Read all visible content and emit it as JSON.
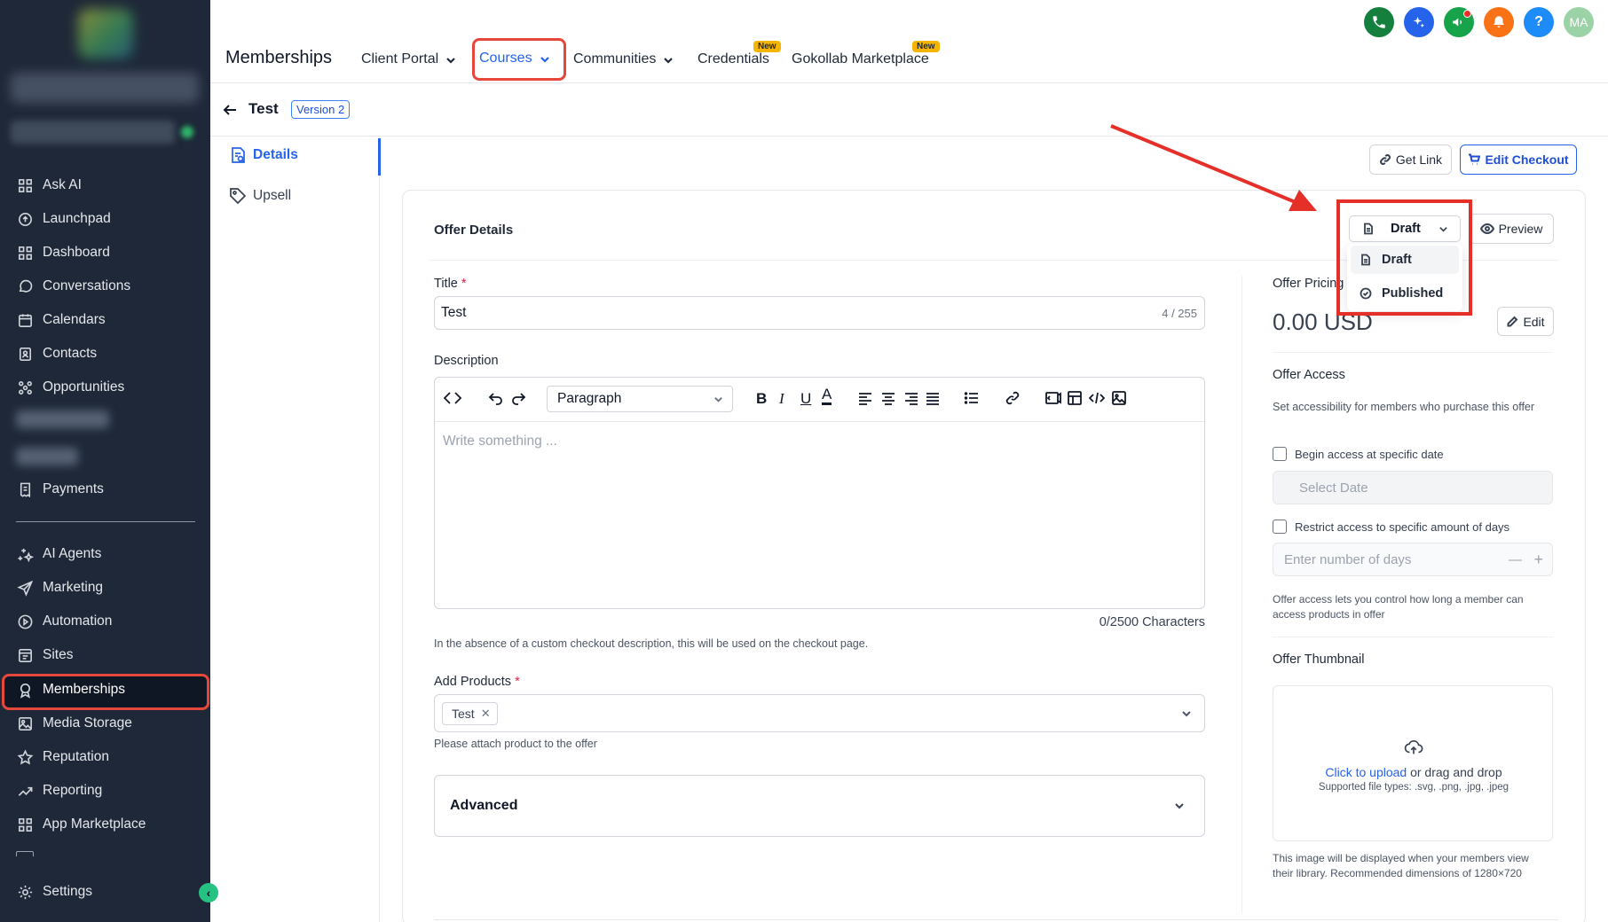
{
  "sidebar": {
    "items": [
      {
        "label": "Ask AI",
        "icon": "grid-icon"
      },
      {
        "label": "Launchpad",
        "icon": "rocket-icon"
      },
      {
        "label": "Dashboard",
        "icon": "grid-icon"
      },
      {
        "label": "Conversations",
        "icon": "chat-bubble-icon"
      },
      {
        "label": "Calendars",
        "icon": "calendar-icon"
      },
      {
        "label": "Contacts",
        "icon": "contacts-book-icon"
      },
      {
        "label": "Opportunities",
        "icon": "pipeline-icon"
      },
      {
        "label": "Payments",
        "icon": "receipt-icon"
      },
      {
        "label": "AI Agents",
        "icon": "sparkles-icon"
      },
      {
        "label": "Marketing",
        "icon": "send-icon"
      },
      {
        "label": "Automation",
        "icon": "play-circle-icon"
      },
      {
        "label": "Sites",
        "icon": "browser-icon"
      },
      {
        "label": "Memberships",
        "icon": "award-icon"
      },
      {
        "label": "Media Storage",
        "icon": "image-icon"
      },
      {
        "label": "Reputation",
        "icon": "star-icon"
      },
      {
        "label": "Reporting",
        "icon": "trend-up-icon"
      },
      {
        "label": "App Marketplace",
        "icon": "grid-icon"
      },
      {
        "label": "Settings",
        "icon": "gear-icon"
      }
    ],
    "active_item": "Memberships"
  },
  "header": {
    "app_title": "Memberships",
    "tabs": [
      {
        "label": "Client Portal",
        "has_dropdown": true
      },
      {
        "label": "Courses",
        "has_dropdown": true,
        "active": true
      },
      {
        "label": "Communities",
        "has_dropdown": true
      },
      {
        "label": "Credentials",
        "badge": "New"
      },
      {
        "label": "Gokollab Marketplace",
        "badge": "New"
      }
    ],
    "icons": [
      {
        "name": "phone-icon",
        "color": "#15803d"
      },
      {
        "name": "ai-sparkle-icon",
        "color": "#2563eb"
      },
      {
        "name": "megaphone-icon",
        "color": "#16a34a"
      },
      {
        "name": "bell-icon",
        "color": "#f97316"
      },
      {
        "name": "help-icon",
        "color": "#1d8cf8"
      }
    ],
    "avatar_initials": "MA"
  },
  "subheader": {
    "title": "Test",
    "version": "Version 2"
  },
  "inner_nav": {
    "items": [
      {
        "label": "Details",
        "active": true
      },
      {
        "label": "Upsell"
      }
    ]
  },
  "actions": {
    "get_link": "Get Link",
    "edit_checkout": "Edit Checkout",
    "preview": "Preview"
  },
  "offer": {
    "section_title": "Offer Details",
    "status": {
      "selected": "Draft",
      "options": [
        "Draft",
        "Published"
      ]
    },
    "title_label": "Title",
    "title_value": "Test",
    "title_counter": "4 / 255",
    "description_label": "Description",
    "editor": {
      "block_style": "Paragraph",
      "placeholder": "Write something ...",
      "char_count": "0/2500 Characters",
      "toolbar_bold": "B",
      "toolbar_italic": "I",
      "toolbar_underline": "U",
      "toolbar_color": "A"
    },
    "description_help": "In the absence of a custom checkout description, this will be used on the checkout page.",
    "products_label": "Add Products",
    "products": [
      "Test"
    ],
    "products_help": "Please attach product to the offer",
    "advanced_label": "Advanced"
  },
  "pricing": {
    "label": "Offer Pricing",
    "amount": "0.00 USD",
    "edit": "Edit"
  },
  "access": {
    "title": "Offer Access",
    "description": "Set accessibility for members who purchase this offer",
    "begin_date_label": "Begin access at specific date",
    "date_placeholder": "Select Date",
    "restrict_days_label": "Restrict access to specific amount of days",
    "days_placeholder": "Enter number of days",
    "help": "Offer access lets you control how long a member can access products in offer"
  },
  "thumbnail": {
    "title": "Offer Thumbnail",
    "upload_link": "Click to upload",
    "upload_text": " or drag and drop",
    "file_types": "Supported file types: .svg, .png, .jpg, .jpeg",
    "help": "This image will be displayed when your members view their library. Recommended dimensions of 1280×720"
  },
  "colors": {
    "sidebar_bg": "#1e2838",
    "accent": "#2563eb",
    "annotation_red": "#e5302a"
  }
}
